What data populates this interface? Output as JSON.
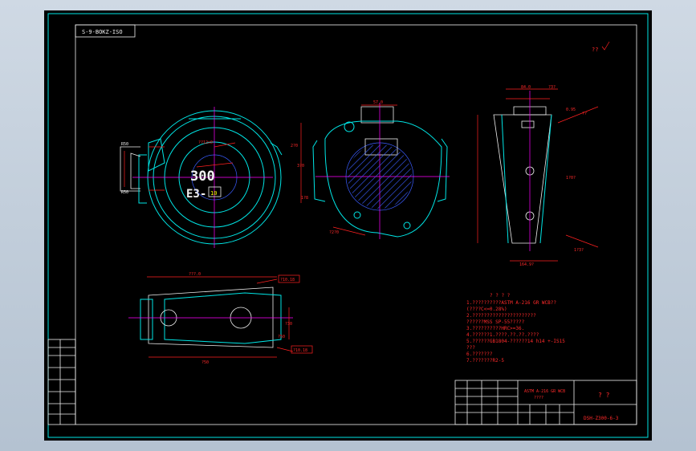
{
  "drawing": {
    "code_stamp": "S-9-BOKZ-ISO",
    "drawing_number": "DSH-Z300-6-3",
    "title_question": "? ?",
    "roughness_mark": "??"
  },
  "top_view": {
    "stamp_number": "300",
    "stamp_code": "E3-",
    "stamp_small": "10",
    "label_top": "??12x0",
    "label_left": "R50",
    "label_left2": "R50"
  },
  "side_view": {
    "dims": [
      "57.0",
      "2?0",
      "3?0",
      "1?8",
      "?2?0"
    ]
  },
  "section_view": {
    "dims": [
      "84.0",
      "?3?",
      "0.95",
      "??",
      "1?0?",
      "164.9?",
      "1?3?"
    ]
  },
  "bottom_view": {
    "dims": [
      "???.0",
      "?10.18",
      "?50",
      "?30",
      "?10.18",
      "?50"
    ]
  },
  "notes": {
    "heading": "? ? ? ?",
    "lines": [
      "1.??????????ASTM A-216 GR WCB??",
      "  (????C<=0.28%)",
      "2.??????????????????????",
      "  ??????MSS SP-55?????",
      "3.??????????HRC>=36.",
      "4.??????1.????.??.??.????",
      "5.??????GB1804-??????14 h14 +-IS15",
      "  ???",
      "6.???????",
      "7.???????R2-5"
    ]
  },
  "title_block": {
    "material": "ASTM A-216 GR WCB",
    "subtitle": "????"
  }
}
